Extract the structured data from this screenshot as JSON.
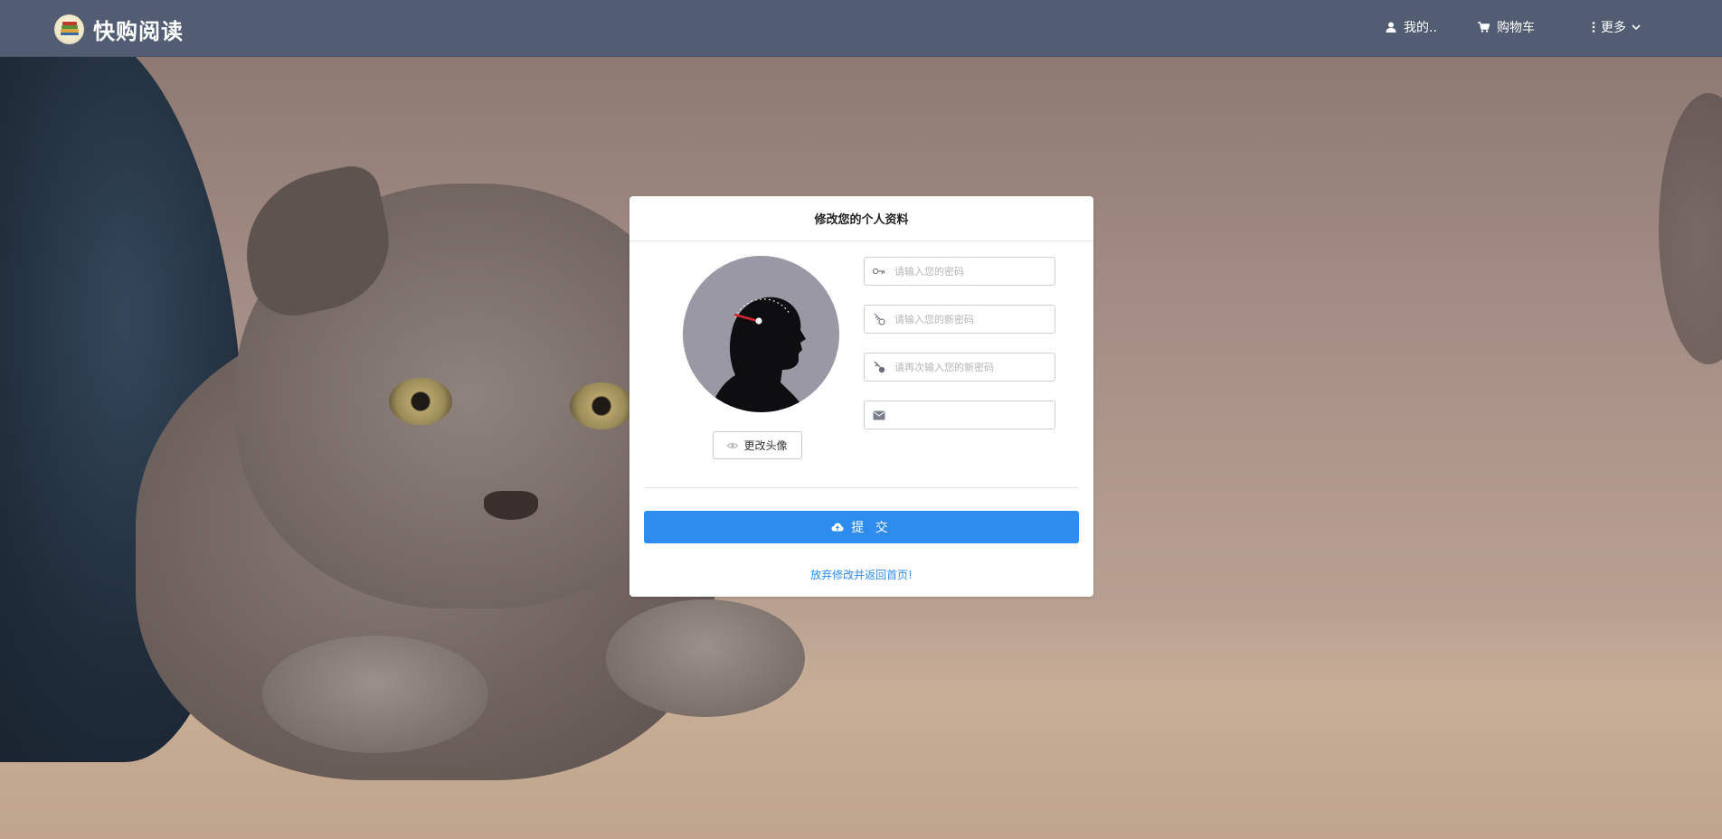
{
  "app": {
    "brand_name": "快购阅读",
    "accent_color": "#2d8ced",
    "nav_color": "#525c72"
  },
  "nav": {
    "mine": {
      "icon": "user-icon",
      "label": "我的.."
    },
    "cart": {
      "icon": "cart-icon",
      "label": "购物车"
    },
    "more": {
      "icon": "vertical-dots-icon",
      "label": "更多"
    }
  },
  "form": {
    "title": "修改您的个人资料",
    "change_avatar": {
      "icon": "eye-icon",
      "label": "更改头像"
    },
    "fields": [
      {
        "icon": "key-icon",
        "placeholder": "请输入您的密码",
        "value": ""
      },
      {
        "icon": "new-key-icon",
        "placeholder": "请输入您的新密码",
        "value": ""
      },
      {
        "icon": "confirm-key-icon",
        "placeholder": "请再次输入您的新密码",
        "value": ""
      },
      {
        "icon": "mail-icon",
        "placeholder": "",
        "value": ""
      }
    ],
    "submit": {
      "icon": "cloud-upload-icon",
      "label": "提 交"
    },
    "back_link": "放弃修改并返回首页!"
  }
}
